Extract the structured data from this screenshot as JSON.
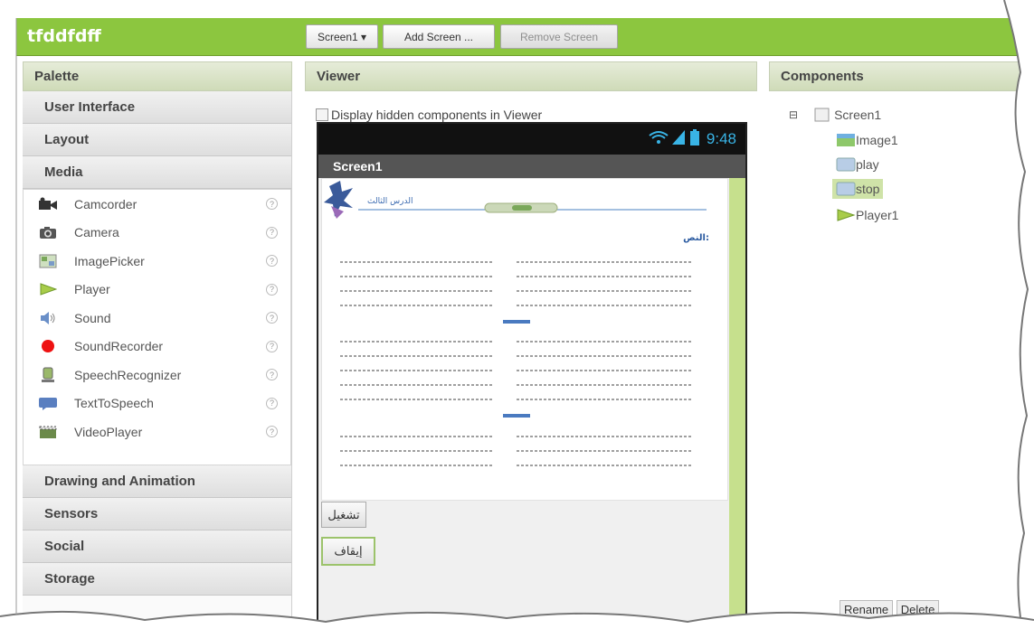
{
  "app": {
    "title": "tfddfdff"
  },
  "toolbar": {
    "screen_select": "Screen1 ▾",
    "add_screen": "Add Screen ...",
    "remove_screen": "Remove Screen"
  },
  "panels": {
    "palette": "Palette",
    "viewer": "Viewer",
    "components": "Components"
  },
  "palette": {
    "categories_top": [
      "User Interface",
      "Layout",
      "Media"
    ],
    "media_items": [
      {
        "label": "Camcorder",
        "icon": "camcorder-icon"
      },
      {
        "label": "Camera",
        "icon": "camera-icon"
      },
      {
        "label": "ImagePicker",
        "icon": "image-picker-icon"
      },
      {
        "label": "Player",
        "icon": "player-icon"
      },
      {
        "label": "Sound",
        "icon": "sound-icon"
      },
      {
        "label": "SoundRecorder",
        "icon": "sound-recorder-icon"
      },
      {
        "label": "SpeechRecognizer",
        "icon": "speech-recognizer-icon"
      },
      {
        "label": "TextToSpeech",
        "icon": "text-to-speech-icon"
      },
      {
        "label": "VideoPlayer",
        "icon": "video-player-icon"
      }
    ],
    "categories_bottom": [
      "Drawing and Animation",
      "Sensors",
      "Social",
      "Storage"
    ],
    "help_glyph": "?"
  },
  "viewer": {
    "hidden_label": "Display hidden components in Viewer",
    "status_time": "9:48",
    "screen_title": "Screen1",
    "doc_heading": "الدرس الثالث",
    "doc_subheading": "النص:",
    "play_label": "تشغيل",
    "stop_label": "إيقاف"
  },
  "components": {
    "tree": [
      {
        "label": "Screen1",
        "icon": "screen-icon"
      },
      {
        "label": "Image1",
        "icon": "image-icon"
      },
      {
        "label": "play",
        "icon": "button-icon"
      },
      {
        "label": "stop",
        "icon": "button-icon",
        "selected": true
      },
      {
        "label": "Player1",
        "icon": "player-icon"
      }
    ],
    "collapse_glyph": "⊟",
    "rename_label": "Rename",
    "delete_label": "Delete"
  },
  "colors": {
    "brand": "#8cc63f",
    "header": "#cfdbb8",
    "selected": "#cfe3a8"
  }
}
